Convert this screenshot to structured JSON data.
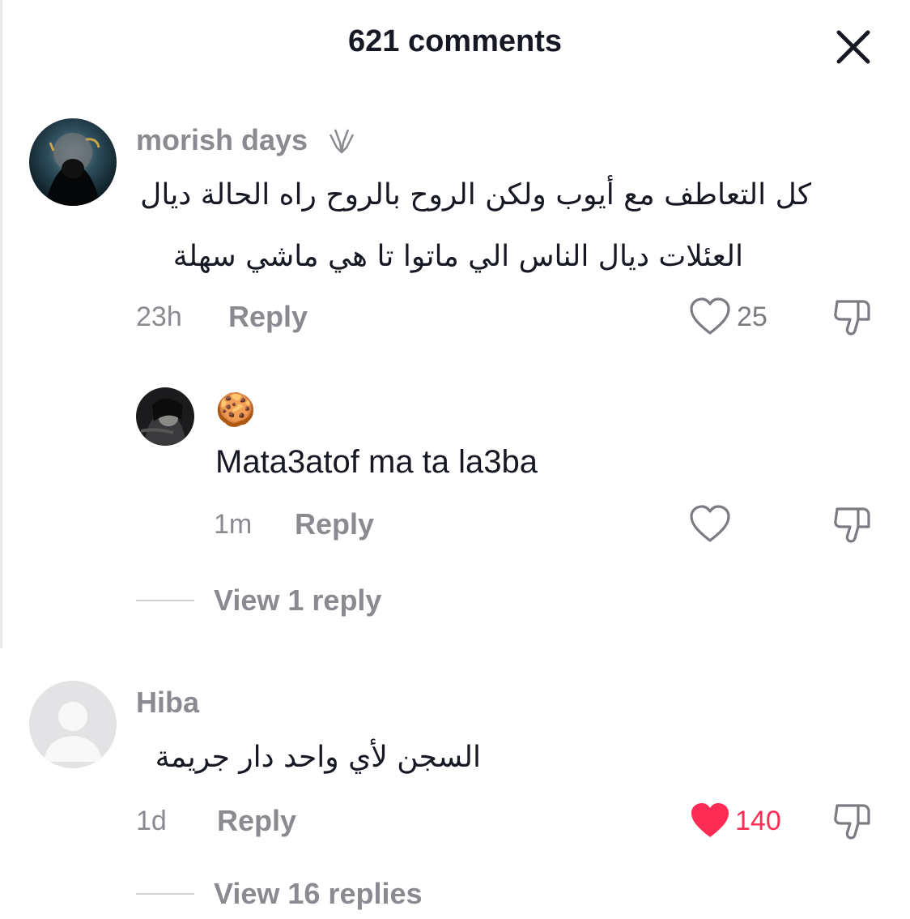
{
  "header": {
    "title": "621 comments"
  },
  "comments": [
    {
      "username": "morish days",
      "badge_icon": "pray-hands-icon",
      "text_line1": "كل التعاطف مع أيوب ولكن الروح بالروح راه الحالة ديال",
      "text_line2": "العئلات ديال الناس الي ماتوا تا هي ماشي سهلة",
      "time": "23h",
      "reply_label": "Reply",
      "likes": "25",
      "liked": false
    },
    {
      "username_emoji": "🍪",
      "text": "Mata3atof ma ta la3ba",
      "time": "1m",
      "reply_label": "Reply",
      "likes": "",
      "liked": false,
      "view_replies": "View 1 reply"
    },
    {
      "username": "Hiba",
      "text": "السجن لأي واحد دار جريمة",
      "time": "1d",
      "reply_label": "Reply",
      "likes": "140",
      "liked": true,
      "view_replies": "View 16 replies"
    }
  ],
  "colors": {
    "text": "#161823",
    "muted": "#8a8b91",
    "like_active": "#fe2c55"
  }
}
